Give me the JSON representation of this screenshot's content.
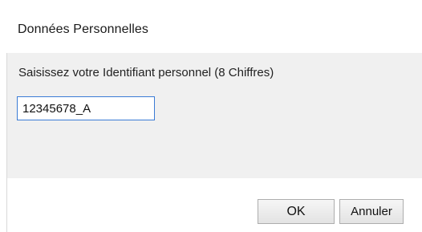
{
  "window": {
    "title": "Données Personnelles"
  },
  "form": {
    "prompt": "Saisissez votre Identifiant personnel  (8 Chiffres)",
    "id_value": "12345678_A"
  },
  "buttons": {
    "ok_label": "OK",
    "cancel_label": "Annuler"
  },
  "colors": {
    "body_bg": "#f0f0f0",
    "input_border": "#3a7bd5"
  }
}
